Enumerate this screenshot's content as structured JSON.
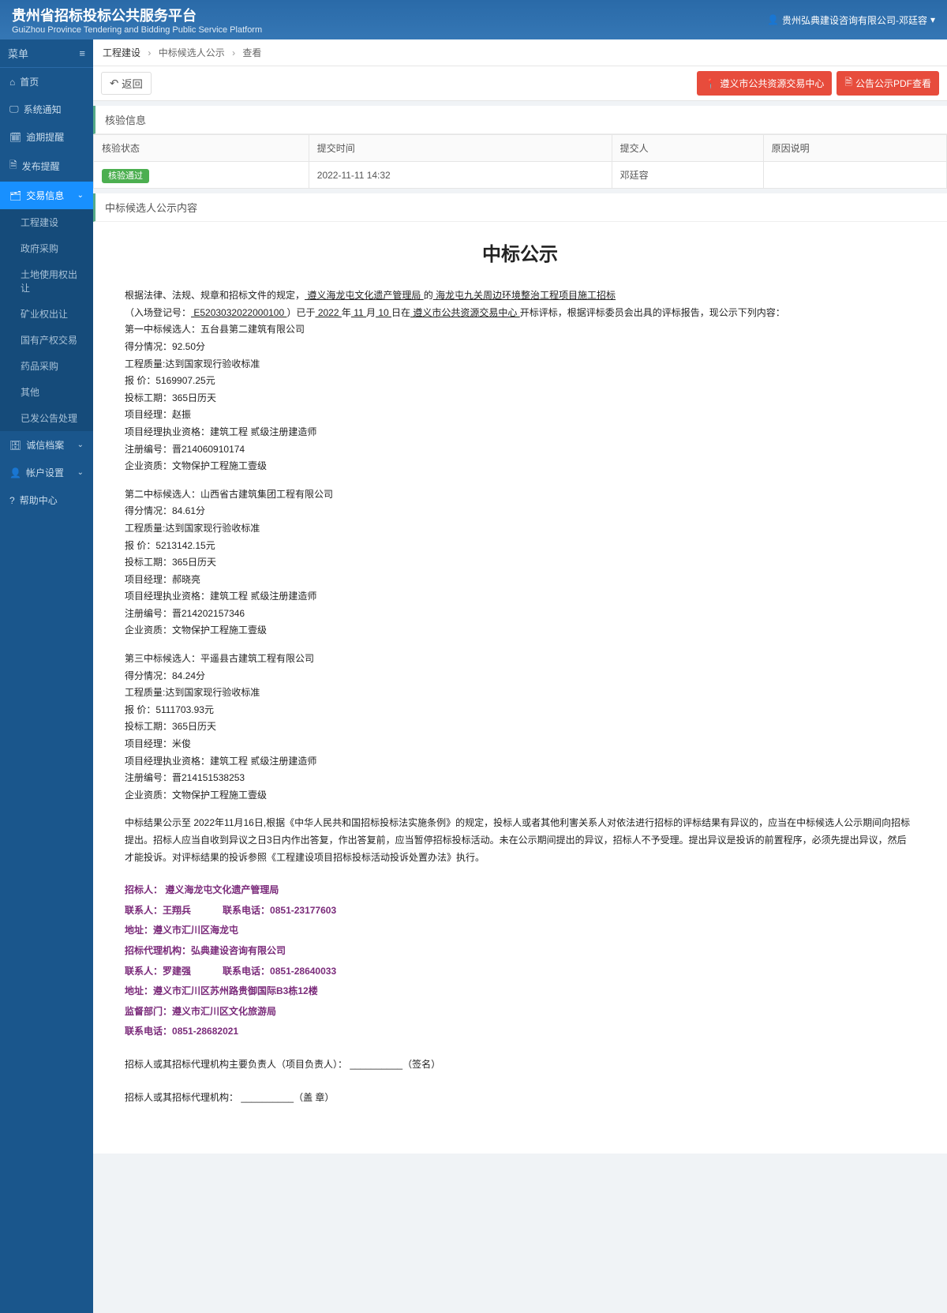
{
  "header": {
    "title": "贵州省招标投标公共服务平台",
    "subtitle": "GuiZhou Province Tendering and Bidding Public Service Platform",
    "user": "贵州弘典建设咨询有限公司-邓廷容"
  },
  "sidebar": {
    "menu_label": "菜单",
    "items": [
      {
        "icon": "home-icon",
        "label": "首页"
      },
      {
        "icon": "monitor-icon",
        "label": "系统通知"
      },
      {
        "icon": "calendar-icon",
        "label": "逾期提醒"
      },
      {
        "icon": "publish-icon",
        "label": "发布提醒"
      },
      {
        "icon": "trade-icon",
        "label": "交易信息",
        "active": true
      }
    ],
    "subitems": [
      "工程建设",
      "政府采购",
      "土地使用权出让",
      "矿业权出让",
      "国有产权交易",
      "药品采购",
      "其他",
      "已发公告处理"
    ],
    "tail": [
      {
        "icon": "archive-icon",
        "label": "诚信档案"
      },
      {
        "icon": "user-icon",
        "label": "帐户设置"
      },
      {
        "icon": "help-icon",
        "label": "帮助中心"
      }
    ]
  },
  "breadcrumb": {
    "a": "工程建设",
    "b": "中标候选人公示",
    "c": "查看"
  },
  "toolbar": {
    "back": "返回",
    "center": "遵义市公共资源交易中心",
    "pdf": "公告公示PDF查看"
  },
  "check": {
    "panel_title": "核验信息",
    "headers": {
      "status": "核验状态",
      "time": "提交时间",
      "submitter": "提交人",
      "reason": "原因说明"
    },
    "row": {
      "status": "核验通过",
      "time": "2022-11-11 14:32",
      "submitter": "邓廷容",
      "reason": ""
    }
  },
  "content": {
    "panel_title": "中标候选人公示内容",
    "title": "中标公示",
    "intro": "根据法律、法规、规章和招标文件的规定，",
    "intro_u1": "  遵义海龙屯文化遗产管理局  ",
    "intro_mid1": "的",
    "intro_u2": "  海龙屯九关周边环境整治工程项目施工招标  ",
    "intro_line2a": "（入场登记号：",
    "intro_u3": "  E5203032022000100  ",
    "intro_line2b": "）已于",
    "intro_u4": "  2022  ",
    "intro_y": "年",
    "intro_u5": "  11  ",
    "intro_m": "月",
    "intro_u6": "  10  ",
    "intro_line2c": "日在",
    "intro_u7": "  遵义市公共资源交易中心  ",
    "intro_line2d": "开标评标，根据评标委员会出具的评标报告，现公示下列内容：",
    "cands": [
      {
        "rank": "第一中标候选人：五台县第二建筑有限公司",
        "score": "得分情况：92.50分",
        "quality": "工程质量:达到国家现行验收标准",
        "price": "报  价：5169907.25元",
        "duration": "投标工期：365日历天",
        "pm": "项目经理：赵振",
        "pm_qual": "项目经理执业资格：建筑工程        贰级注册建造师",
        "reg": "注册编号：晋214060910174",
        "corp": "企业资质：文物保护工程施工壹级"
      },
      {
        "rank": "第二中标候选人：山西省古建筑集团工程有限公司",
        "score": "得分情况：84.61分",
        "quality": "工程质量:达到国家现行验收标准",
        "price": "报  价：5213142.15元",
        "duration": "投标工期：365日历天",
        "pm": "项目经理：郝晓亮",
        "pm_qual": "项目经理执业资格：建筑工程       贰级注册建造师",
        "reg": "注册编号：晋214202157346",
        "corp": "企业资质：文物保护工程施工壹级"
      },
      {
        "rank": "第三中标候选人：平遥县古建筑工程有限公司",
        "score": "得分情况：84.24分",
        "quality": "工程质量:达到国家现行验收标准",
        "price": "报  价：5111703.93元",
        "duration": "投标工期：365日历天",
        "pm": "项目经理：米俊",
        "pm_qual": "项目经理执业资格：建筑工程        贰级注册建造师",
        "reg": "注册编号：晋214151538253",
        "corp": "企业资质：文物保护工程施工壹级"
      }
    ],
    "notice": "中标结果公示至 2022年11月16日,根据《中华人民共和国招标投标法实施条例》的规定，投标人或者其他利害关系人对依法进行招标的评标结果有异议的，应当在中标候选人公示期间向招标提出。招标人应当自收到异议之日3日内作出答复，作出答复前，应当暂停招标投标活动。未在公示期间提出的异议，招标人不予受理。提出异议是投诉的前置程序，必须先提出异议，然后才能投诉。对评标结果的投诉参照《工程建设项目招标投标活动投诉处置办法》执行。",
    "info": {
      "tenderer_lbl": "招标人：",
      "tenderer": "遵义海龙屯文化遗产管理局",
      "contact1_lbl": "联系人：",
      "contact1": "王翔兵",
      "phone1_lbl": "联系电话：",
      "phone1": "0851-23177603",
      "addr1_lbl": "地址：",
      "addr1": "遵义市汇川区海龙屯",
      "agency_lbl": "招标代理机构：",
      "agency": "弘典建设咨询有限公司",
      "contact2_lbl": "联系人：",
      "contact2": "罗建强",
      "phone2_lbl": "联系电话：",
      "phone2": "0851-28640033",
      "addr2_lbl": "地址：",
      "addr2": "遵义市汇川区苏州路贵御国际B3栋12楼",
      "supervise_lbl": "监督部门：",
      "supervise": "遵义市汇川区文化旅游局",
      "phone3_lbl": "联系电话：",
      "phone3": "0851-28682021"
    },
    "sign1": "招标人或其招标代理机构主要负责人（项目负责人）： __________（签名）",
    "sign2": "招标人或其招标代理机构： __________（盖  章）"
  }
}
